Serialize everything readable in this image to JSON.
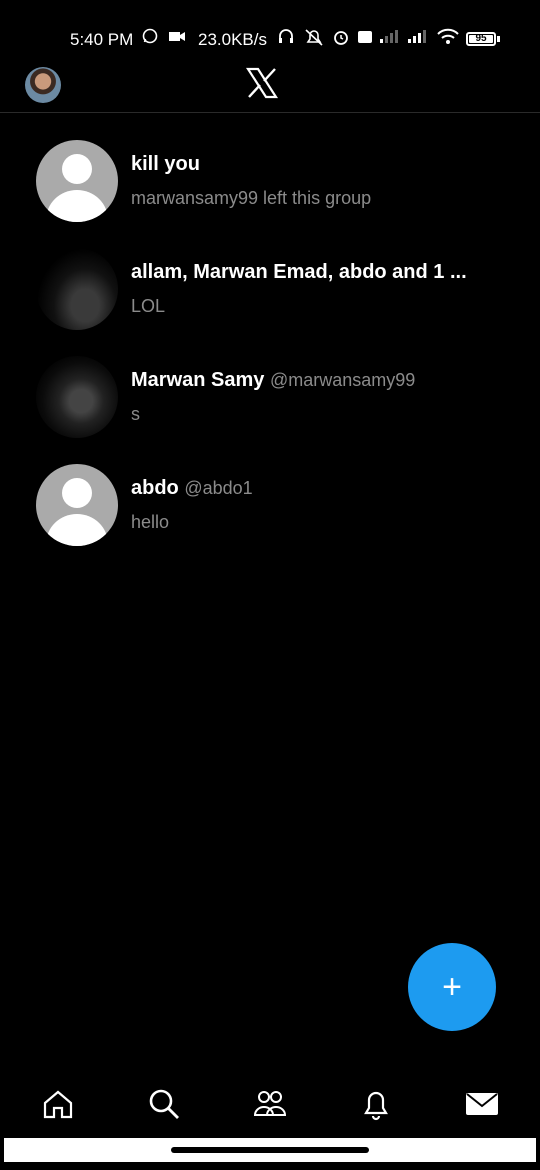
{
  "status_bar": {
    "time": "5:40 PM",
    "net_speed": "23.0KB/s",
    "battery": "95"
  },
  "header": {
    "logo": "x-logo-icon"
  },
  "conversations": [
    {
      "name": "kill you",
      "handle": "",
      "message": "marwansamy99 left this group",
      "avatar": "default-avatar"
    },
    {
      "name": "allam, Marwan Emad, abdo and 1 ...",
      "handle": "",
      "message": "LOL",
      "avatar": "group-photo"
    },
    {
      "name": "Marwan Samy",
      "handle": "@marwansamy99",
      "message": "s",
      "avatar": "anime-photo"
    },
    {
      "name": "abdo",
      "handle": "@abdo1",
      "message": "hello",
      "avatar": "default-avatar"
    }
  ],
  "fab": {
    "label": "+",
    "icon": "new-message-icon",
    "color": "#1d9bf0"
  },
  "bottom_nav": [
    "home-icon",
    "search-icon",
    "communities-icon",
    "notifications-icon",
    "messages-icon"
  ]
}
